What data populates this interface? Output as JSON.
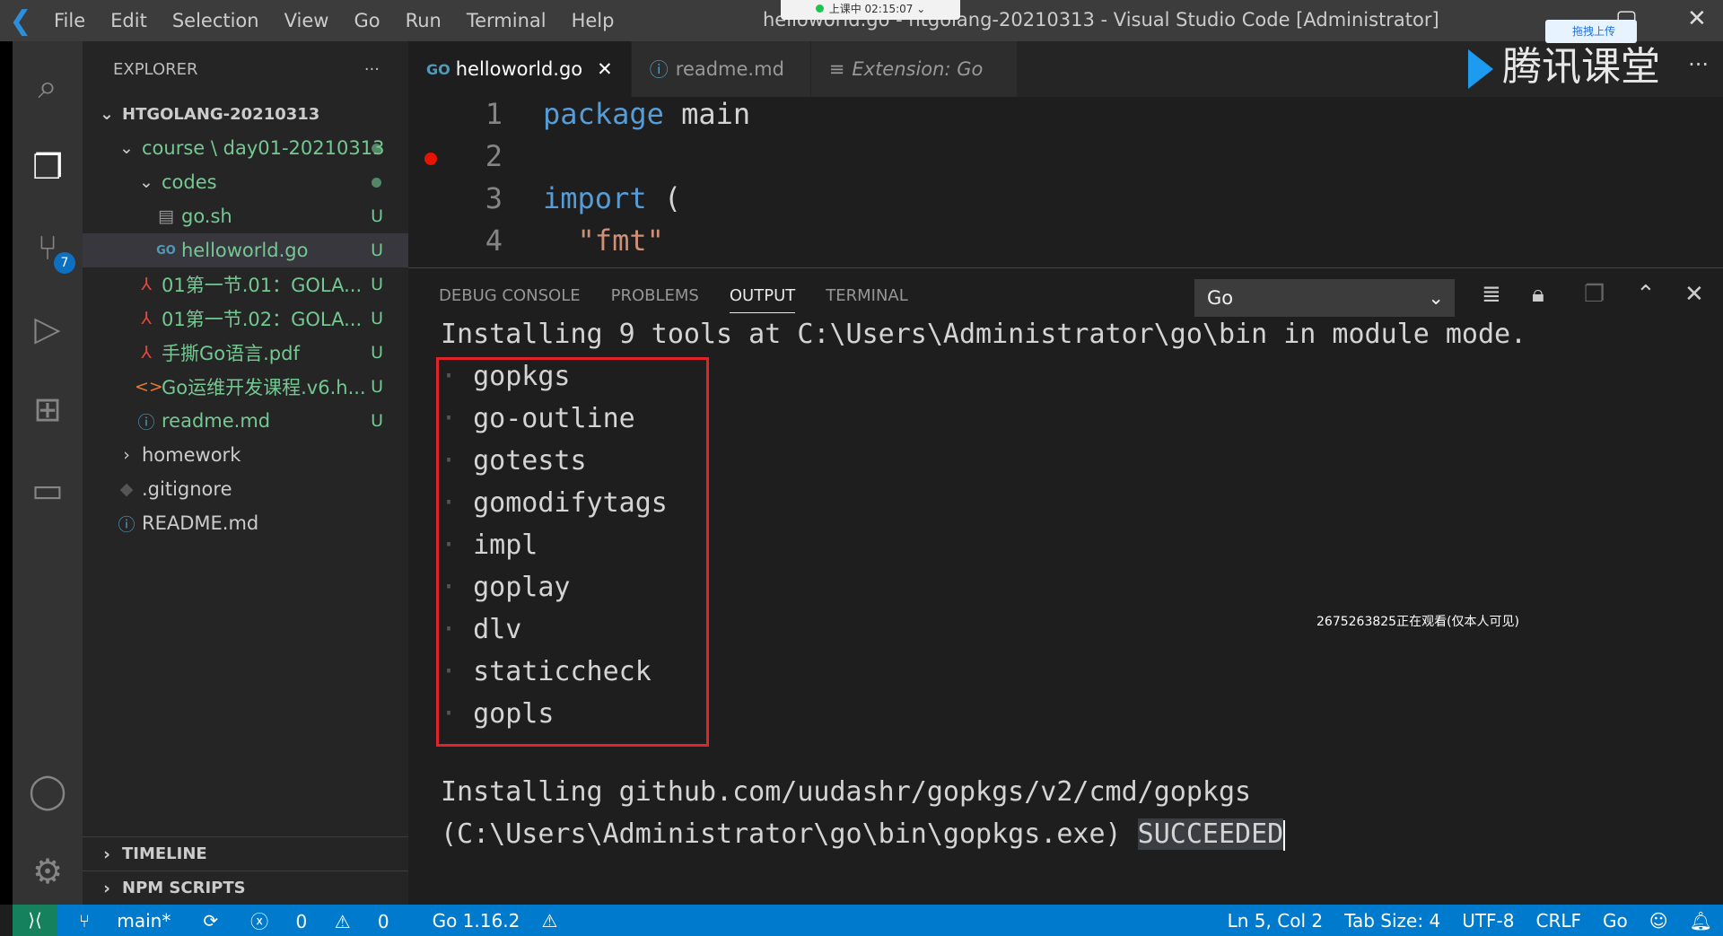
{
  "titlebar": {
    "menu": [
      "File",
      "Edit",
      "Selection",
      "View",
      "Go",
      "Run",
      "Terminal",
      "Help"
    ],
    "title": "helloworld.go - htgolang-20210313 - Visual Studio Code [Administrator]",
    "recording": "上课中 02:15:07",
    "upload_label": "拖拽上传",
    "brand": "腾讯课堂"
  },
  "activity": {
    "scm_badge": "7"
  },
  "sidebar": {
    "title": "EXPLORER",
    "more": "···",
    "root": "HTGOLANG-20210313",
    "items": [
      {
        "label": "course \\ day01-20210313",
        "status": "",
        "indent": 1,
        "type": "folder-open",
        "icon": "chevron-down"
      },
      {
        "label": "codes",
        "status": "",
        "indent": 2,
        "type": "folder-open",
        "icon": "chevron-down"
      },
      {
        "label": "go.sh",
        "status": "U",
        "indent": 3,
        "type": "file",
        "icon": "file-lines"
      },
      {
        "label": "helloworld.go",
        "status": "U",
        "indent": 3,
        "type": "file",
        "icon": "go",
        "selected": true
      },
      {
        "label": "01第一节.01：GOLA...",
        "status": "U",
        "indent": 2,
        "type": "file",
        "icon": "pdf"
      },
      {
        "label": "01第一节.02：GOLA...",
        "status": "U",
        "indent": 2,
        "type": "file",
        "icon": "pdf"
      },
      {
        "label": "手撕Go语言.pdf",
        "status": "U",
        "indent": 2,
        "type": "file",
        "icon": "pdf"
      },
      {
        "label": "Go运维开发课程.v6.h...",
        "status": "U",
        "indent": 2,
        "type": "file",
        "icon": "html"
      },
      {
        "label": "readme.md",
        "status": "U",
        "indent": 2,
        "type": "file",
        "icon": "info"
      },
      {
        "label": "homework",
        "status": "",
        "indent": 1,
        "type": "folder",
        "icon": "chevron-right"
      },
      {
        "label": ".gitignore",
        "status": "",
        "indent": 1,
        "type": "file",
        "icon": "git"
      },
      {
        "label": "README.md",
        "status": "",
        "indent": 1,
        "type": "file",
        "icon": "info"
      }
    ],
    "timeline": "TIMELINE",
    "npm": "NPM SCRIPTS"
  },
  "tabs": [
    {
      "label": "helloworld.go",
      "close": "✕"
    },
    {
      "label": "readme.md"
    },
    {
      "label": "Extension: Go"
    }
  ],
  "editor": {
    "lines": [
      "1",
      "2",
      "3",
      "4"
    ]
  },
  "panel": {
    "tabs": [
      "DEBUG CONSOLE",
      "PROBLEMS",
      "OUTPUT",
      "TERMINAL"
    ],
    "channel": "Go",
    "header_line": "Installing 9 tools at C:\\Users\\Administrator\\go\\bin in module mode.",
    "tools": [
      "gopkgs",
      "go-outline",
      "gotests",
      "gomodifytags",
      "impl",
      "goplay",
      "dlv",
      "staticcheck",
      "gopls"
    ],
    "install_line1": "Installing github.com/uudashr/gopkgs/v2/cmd/gopkgs",
    "install_line2": "(C:\\Users\\Administrator\\go\\bin\\gopkgs.exe)",
    "succeeded": "SUCCEEDED"
  },
  "overlay": {
    "watching": "2675263825正在观看(仅本人可见)"
  },
  "status": {
    "branch": "main*",
    "errors": "0",
    "warnings": "0",
    "go_version": "Go 1.16.2",
    "cursor": "Ln 5, Col 2",
    "tab_size": "Tab Size: 4",
    "encoding": "UTF-8",
    "eol": "CRLF",
    "language": "Go"
  }
}
